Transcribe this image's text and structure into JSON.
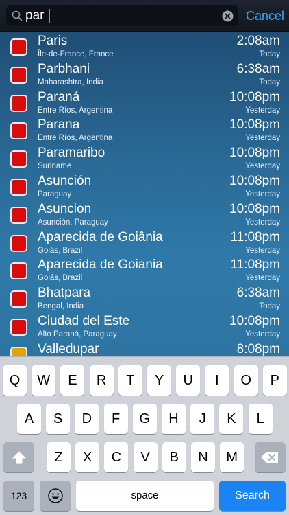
{
  "search": {
    "query": "par",
    "cancel_label": "Cancel"
  },
  "colors": {
    "accent": "#3aa2f2",
    "swatch_red": "#d80c0c",
    "swatch_orange": "#e0a400",
    "search_key": "#1a84f5"
  },
  "results": [
    {
      "city": "Paris",
      "region": "Île-de-France, France",
      "time": "2:08am",
      "day": "Today",
      "swatch": "red"
    },
    {
      "city": "Parbhani",
      "region": "Maharashtra, India",
      "time": "6:38am",
      "day": "Today",
      "swatch": "red"
    },
    {
      "city": "Paraná",
      "region": "Entre Ríos, Argentina",
      "time": "10:08pm",
      "day": "Yesterday",
      "swatch": "red"
    },
    {
      "city": "Parana",
      "region": "Entre Ríos, Argentina",
      "time": "10:08pm",
      "day": "Yesterday",
      "swatch": "red"
    },
    {
      "city": "Paramaribo",
      "region": "Suriname",
      "time": "10:08pm",
      "day": "Yesterday",
      "swatch": "red"
    },
    {
      "city": "Asunción",
      "region": "Paraguay",
      "time": "10:08pm",
      "day": "Yesterday",
      "swatch": "red"
    },
    {
      "city": "Asuncion",
      "region": "Asunción, Paraguay",
      "time": "10:08pm",
      "day": "Yesterday",
      "swatch": "red"
    },
    {
      "city": "Aparecida de Goiânia",
      "region": "Goiás, Brazil",
      "time": "11:08pm",
      "day": "Yesterday",
      "swatch": "red"
    },
    {
      "city": "Aparecida de Goiania",
      "region": "Goiás, Brazil",
      "time": "11:08pm",
      "day": "Yesterday",
      "swatch": "red"
    },
    {
      "city": "Bhatpara",
      "region": "Bengal, India",
      "time": "6:38am",
      "day": "Today",
      "swatch": "red"
    },
    {
      "city": "Ciudad del Este",
      "region": "Alto Paraná, Paraguay",
      "time": "10:08pm",
      "day": "Yesterday",
      "swatch": "red"
    },
    {
      "city": "Valledupar",
      "region": "",
      "time": "8:08pm",
      "day": "",
      "swatch": "orange"
    }
  ],
  "keyboard": {
    "row1": [
      "Q",
      "W",
      "E",
      "R",
      "T",
      "Y",
      "U",
      "I",
      "O",
      "P"
    ],
    "row2": [
      "A",
      "S",
      "D",
      "F",
      "G",
      "H",
      "J",
      "K",
      "L"
    ],
    "row3": [
      "Z",
      "X",
      "C",
      "V",
      "B",
      "N",
      "M"
    ],
    "shift_icon": "shift-arrow-icon",
    "delete_icon": "backspace-icon",
    "numbers_label": "123",
    "emoji_icon": "emoji-smiley-icon",
    "space_label": "space",
    "search_label": "Search"
  }
}
